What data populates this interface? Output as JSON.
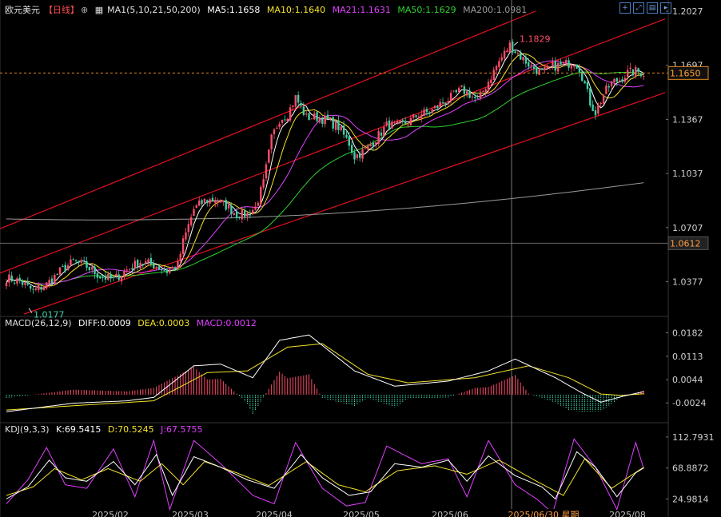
{
  "header": {
    "symbol": "欧元美元",
    "period": "【日线】",
    "period_icon": "target-icon",
    "ma_label": "MA1(5,10,21,50,200)",
    "ma_values": [
      {
        "label": "MA5:1.1658",
        "color": "#ffffff"
      },
      {
        "label": "MA10:1.1640",
        "color": "#f5e32a"
      },
      {
        "label": "MA21:1.1631",
        "color": "#e040ff"
      },
      {
        "label": "MA50:1.1629",
        "color": "#30d030"
      },
      {
        "label": "MA200:1.0981",
        "color": "#9a9a9a"
      }
    ]
  },
  "toolbar": {
    "icons": [
      "zoom-in-icon",
      "expand-icon",
      "chart-icon",
      "play-icon"
    ]
  },
  "macd_header": {
    "label": "MACD(26,12,9)",
    "diff": "DIFF:0.0009",
    "dea": "DEA:0.0003",
    "macd": "MACD:0.0012"
  },
  "kdj_header": {
    "label": "KDJ(9,3,3)",
    "k": "K:69.5415",
    "d": "D:70.5245",
    "j": "J:67.5755"
  },
  "colors": {
    "up": "#ff4d6a",
    "down": "#3fd0a8",
    "channel": "#e01020",
    "ma5": "#ffffff",
    "ma10": "#f5e32a",
    "ma21": "#e040ff",
    "ma50": "#30d030",
    "ma200": "#9a9a9a",
    "diff": "#ffffff",
    "dea": "#f5e32a",
    "k": "#ffffff",
    "d": "#f5e32a",
    "j": "#e040ff"
  },
  "chart_data": [
    {
      "type": "candlestick",
      "name": "price",
      "ylim": [
        1.018,
        1.2027
      ],
      "y_ticks": [
        "1.2027",
        "1.1697",
        "1.1367",
        "1.1037",
        "1.0707",
        "1.0377"
      ],
      "x_ticks": [
        "2025/02",
        "2025/03",
        "2025/04",
        "2025/05",
        "2025/06",
        "2025/06/30 星期",
        "2025/08"
      ],
      "annotations": {
        "high": "1.1829",
        "low": "1.0177"
      },
      "current_price": "1.1650",
      "crosshair_price": "1.0612",
      "anchors": [
        [
          0,
          1.04
        ],
        [
          5,
          1.038
        ],
        [
          10,
          1.032
        ],
        [
          15,
          1.036
        ],
        [
          20,
          1.044
        ],
        [
          25,
          1.05
        ],
        [
          30,
          1.047
        ],
        [
          35,
          1.041
        ],
        [
          40,
          1.039
        ],
        [
          45,
          1.045
        ],
        [
          50,
          1.05
        ],
        [
          55,
          1.048
        ],
        [
          60,
          1.044
        ],
        [
          64,
          1.048
        ],
        [
          66,
          1.062
        ],
        [
          70,
          1.082
        ],
        [
          74,
          1.087
        ],
        [
          78,
          1.088
        ],
        [
          82,
          1.084
        ],
        [
          86,
          1.079
        ],
        [
          90,
          1.079
        ],
        [
          93,
          1.083
        ],
        [
          96,
          1.098
        ],
        [
          99,
          1.125
        ],
        [
          102,
          1.137
        ],
        [
          105,
          1.14
        ],
        [
          108,
          1.15
        ],
        [
          112,
          1.138
        ],
        [
          116,
          1.138
        ],
        [
          120,
          1.136
        ],
        [
          124,
          1.132
        ],
        [
          128,
          1.122
        ],
        [
          130,
          1.114
        ],
        [
          134,
          1.118
        ],
        [
          138,
          1.125
        ],
        [
          142,
          1.133
        ],
        [
          146,
          1.133
        ],
        [
          150,
          1.135
        ],
        [
          154,
          1.14
        ],
        [
          158,
          1.141
        ],
        [
          162,
          1.146
        ],
        [
          166,
          1.15
        ],
        [
          170,
          1.155
        ],
        [
          173,
          1.152
        ],
        [
          176,
          1.148
        ],
        [
          180,
          1.16
        ],
        [
          184,
          1.172
        ],
        [
          188,
          1.182
        ],
        [
          192,
          1.175
        ],
        [
          196,
          1.169
        ],
        [
          200,
          1.165
        ],
        [
          204,
          1.169
        ],
        [
          208,
          1.17
        ],
        [
          212,
          1.172
        ],
        [
          214,
          1.168
        ],
        [
          216,
          1.158
        ],
        [
          218,
          1.147
        ],
        [
          220,
          1.141
        ],
        [
          223,
          1.152
        ],
        [
          226,
          1.159
        ],
        [
          229,
          1.161
        ],
        [
          232,
          1.165
        ],
        [
          235,
          1.166
        ],
        [
          238,
          1.165
        ]
      ],
      "ma200_start": 1.076,
      "ma200_end": 1.0981
    },
    {
      "type": "bar",
      "name": "macd",
      "ylim": [
        -0.0073,
        0.0188
      ],
      "y_ticks": [
        "0.0182",
        "0.0113",
        "0.0044",
        "-0.0024"
      ],
      "diff_anchors": [
        [
          0,
          -0.005
        ],
        [
          25,
          -0.0025
        ],
        [
          45,
          -0.0018
        ],
        [
          55,
          -0.0008
        ],
        [
          70,
          0.0085
        ],
        [
          80,
          0.009
        ],
        [
          92,
          0.005
        ],
        [
          102,
          0.016
        ],
        [
          113,
          0.0176
        ],
        [
          130,
          0.007
        ],
        [
          145,
          0.0025
        ],
        [
          165,
          0.004
        ],
        [
          180,
          0.007
        ],
        [
          190,
          0.0105
        ],
        [
          205,
          0.005
        ],
        [
          215,
          0.0005
        ],
        [
          222,
          -0.0022
        ],
        [
          230,
          -0.0005
        ],
        [
          238,
          0.0009
        ]
      ],
      "dea_anchors": [
        [
          0,
          -0.0045
        ],
        [
          30,
          -0.003
        ],
        [
          55,
          -0.0018
        ],
        [
          75,
          0.0065
        ],
        [
          90,
          0.007
        ],
        [
          105,
          0.014
        ],
        [
          118,
          0.015
        ],
        [
          135,
          0.006
        ],
        [
          150,
          0.0035
        ],
        [
          175,
          0.005
        ],
        [
          195,
          0.0085
        ],
        [
          210,
          0.005
        ],
        [
          222,
          0.0002
        ],
        [
          230,
          -0.0002
        ],
        [
          238,
          0.0003
        ]
      ]
    },
    {
      "type": "line",
      "name": "kdj",
      "ylim": [
        5,
        115
      ],
      "y_ticks": [
        "112.7931",
        "68.8872",
        "24.9814"
      ],
      "k_anchors": [
        [
          0,
          25
        ],
        [
          8,
          42
        ],
        [
          16,
          80
        ],
        [
          22,
          55
        ],
        [
          30,
          50
        ],
        [
          40,
          78
        ],
        [
          48,
          45
        ],
        [
          56,
          88
        ],
        [
          62,
          30
        ],
        [
          70,
          85
        ],
        [
          80,
          70
        ],
        [
          90,
          52
        ],
        [
          100,
          40
        ],
        [
          110,
          88
        ],
        [
          118,
          55
        ],
        [
          128,
          30
        ],
        [
          136,
          35
        ],
        [
          145,
          75
        ],
        [
          155,
          70
        ],
        [
          165,
          80
        ],
        [
          172,
          50
        ],
        [
          180,
          86
        ],
        [
          190,
          58
        ],
        [
          200,
          42
        ],
        [
          205,
          25
        ],
        [
          213,
          92
        ],
        [
          220,
          70
        ],
        [
          228,
          28
        ],
        [
          235,
          62
        ],
        [
          238,
          69
        ]
      ],
      "d_anchors": [
        [
          0,
          30
        ],
        [
          10,
          42
        ],
        [
          18,
          68
        ],
        [
          28,
          52
        ],
        [
          38,
          68
        ],
        [
          50,
          50
        ],
        [
          58,
          75
        ],
        [
          66,
          45
        ],
        [
          74,
          78
        ],
        [
          86,
          62
        ],
        [
          98,
          44
        ],
        [
          112,
          78
        ],
        [
          124,
          45
        ],
        [
          134,
          35
        ],
        [
          146,
          65
        ],
        [
          160,
          72
        ],
        [
          172,
          60
        ],
        [
          184,
          80
        ],
        [
          198,
          50
        ],
        [
          208,
          30
        ],
        [
          216,
          82
        ],
        [
          226,
          40
        ],
        [
          238,
          70
        ]
      ],
      "j_anchors": [
        [
          0,
          18
        ],
        [
          8,
          52
        ],
        [
          15,
          98
        ],
        [
          22,
          45
        ],
        [
          30,
          40
        ],
        [
          40,
          96
        ],
        [
          48,
          28
        ],
        [
          55,
          108
        ],
        [
          61,
          10
        ],
        [
          70,
          108
        ],
        [
          80,
          75
        ],
        [
          92,
          30
        ],
        [
          100,
          18
        ],
        [
          108,
          105
        ],
        [
          118,
          40
        ],
        [
          127,
          15
        ],
        [
          134,
          20
        ],
        [
          142,
          100
        ],
        [
          155,
          75
        ],
        [
          165,
          82
        ],
        [
          172,
          28
        ],
        [
          180,
          108
        ],
        [
          190,
          45
        ],
        [
          198,
          25
        ],
        [
          204,
          5
        ],
        [
          212,
          110
        ],
        [
          220,
          70
        ],
        [
          228,
          10
        ],
        [
          235,
          105
        ],
        [
          238,
          68
        ]
      ]
    }
  ]
}
